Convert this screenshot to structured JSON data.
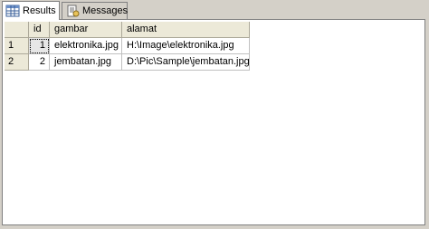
{
  "tabs": [
    {
      "label": "Results",
      "icon": "grid-icon",
      "active": true
    },
    {
      "label": "Messages",
      "icon": "messages-icon",
      "active": false
    }
  ],
  "grid": {
    "columns": [
      "id",
      "gambar",
      "alamat"
    ],
    "rows": [
      {
        "row_number": "1",
        "id": "1",
        "gambar": "elektronika.jpg",
        "alamat": "H:\\Image\\elektronika.jpg"
      },
      {
        "row_number": "2",
        "id": "2",
        "gambar": "jembatan.jpg",
        "alamat": "D:\\Pic\\Sample\\jembatan.jpg"
      }
    ]
  }
}
